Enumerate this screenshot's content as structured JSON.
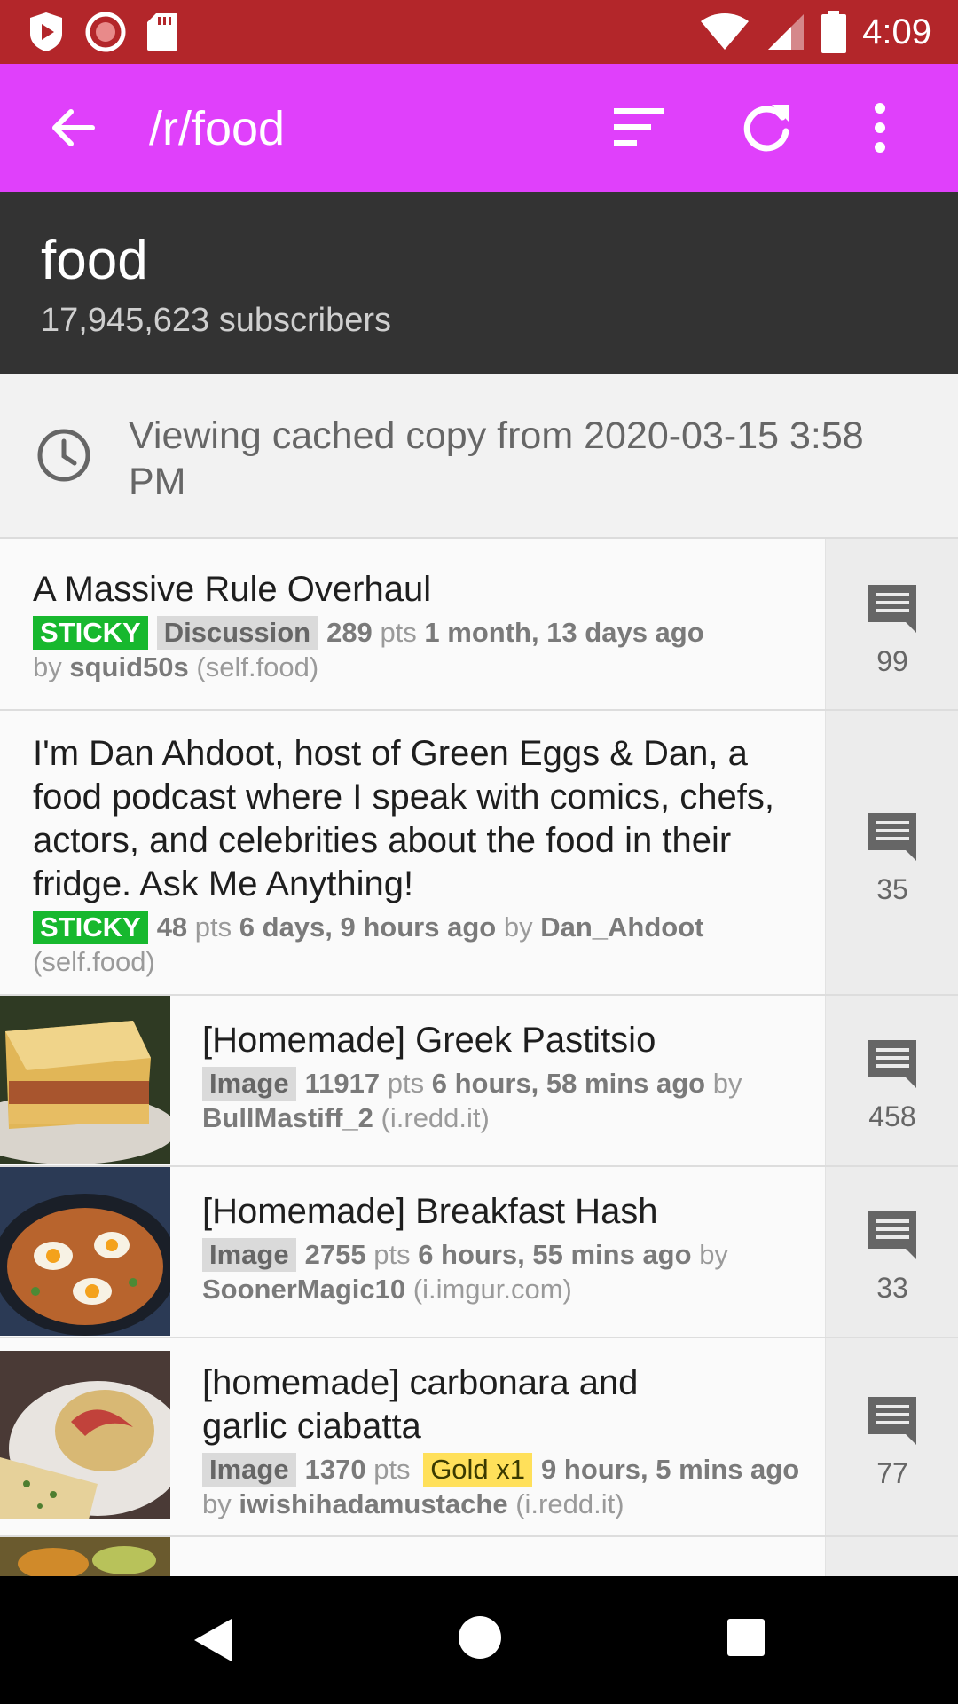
{
  "status_bar": {
    "time": "4:09",
    "bg_color": "#b3262a",
    "left_icons": [
      "play-shield-icon",
      "record-icon",
      "sd-card-icon"
    ],
    "right_icons": [
      "wifi-icon",
      "signal-icon",
      "battery-icon"
    ]
  },
  "toolbar": {
    "title": "/r/food",
    "bg_color": "#e040fb",
    "icons": [
      "back-arrow-icon",
      "sort-icon",
      "refresh-icon",
      "more-vert-icon"
    ]
  },
  "subreddit": {
    "name": "food",
    "subscribers": "17,945,623 subscribers"
  },
  "cache_notice": {
    "text": "Viewing cached copy from 2020-03-15 3:58 PM"
  },
  "posts": [
    {
      "title": "A Massive Rule Overhaul",
      "sticky": "STICKY",
      "flair": "Discussion",
      "points": "289",
      "pts_label": "pts",
      "age": "1 month, 13 days ago",
      "by_label": "by",
      "author": "squid50s",
      "domain": "(self.food)",
      "comments": "99"
    },
    {
      "title": "I'm Dan Ahdoot, host of Green Eggs & Dan, a food podcast where I speak with comics, chefs, actors, and celebrities about the food in their fridge. Ask Me Anything!",
      "sticky": "STICKY",
      "points": "48",
      "pts_label": "pts",
      "age": "6 days, 9 hours ago",
      "by_label": "by",
      "author": "Dan_Ahdoot",
      "domain": "(self.food)",
      "comments": "35"
    },
    {
      "title": "[Homemade] Greek Pastitsio",
      "flair": "Image",
      "points": "11917",
      "pts_label": "pts",
      "age": "6 hours, 58 mins ago",
      "by_label": "by",
      "author": "BullMastiff_2",
      "domain": "(i.redd.it)",
      "comments": "458"
    },
    {
      "title": "[Homemade] Breakfast Hash",
      "flair": "Image",
      "points": "2755",
      "pts_label": "pts",
      "age": "6 hours, 55 mins ago",
      "by_label": "by",
      "author": "SoonerMagic10",
      "domain": "(i.imgur.com)",
      "comments": "33"
    },
    {
      "title": "[homemade] carbonara and garlic ciabatta",
      "flair": "Image",
      "points": "1370",
      "pts_label": "pts",
      "gold": "Gold x1",
      "age": "9 hours, 5 mins ago",
      "by_label": "by",
      "author": "iwishihadamustache",
      "domain": "(i.redd.it)",
      "comments": "77"
    }
  ],
  "nav_bar": {
    "icons": [
      "back-triangle-icon",
      "home-circle-icon",
      "recents-square-icon"
    ]
  }
}
